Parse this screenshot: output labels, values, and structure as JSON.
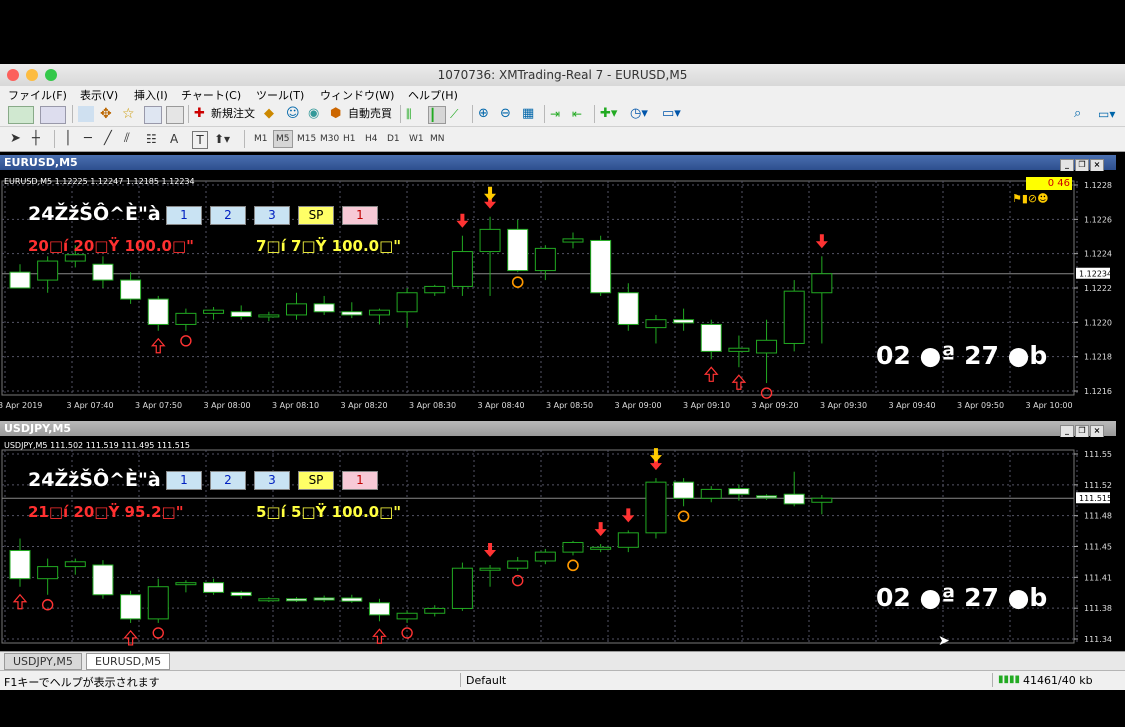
{
  "window": {
    "title": "1070736: XMTrading-Real 7 - EURUSD,M5"
  },
  "menu": [
    "ファイル(F)",
    "表示(V)",
    "挿入(I)",
    "チャート(C)",
    "ツール(T)",
    "ウィンドウ(W)",
    "ヘルプ(H)"
  ],
  "toolbar": {
    "new_order": "新規注文",
    "auto_trade": "自動売買"
  },
  "timeframes": [
    "M1",
    "M5",
    "M15",
    "M30",
    "H1",
    "H4",
    "D1",
    "W1",
    "MN"
  ],
  "active_timeframe": "M5",
  "panes": [
    {
      "title": "EURUSD,M5",
      "info": "EURUSD,M5  1.12225 1.12247 1.12185 1.12234",
      "headline": "24ŽžŠÔ^È\"à",
      "buttons": [
        "1",
        "2",
        "3",
        "SP",
        "1"
      ],
      "stats_left": "20□í 20□Ÿ  100.0□\"",
      "stats_right": "7□í 7□Ÿ  100.0□\"",
      "countdown": "02 ●ª 27 ●b",
      "timer_badge": "0 46",
      "current_price": "1.12234",
      "price_labels": [
        "1.12285",
        "1.12265",
        "1.12245",
        "1.12225",
        "1.12205",
        "1.12185",
        "1.12165"
      ],
      "time_labels": [
        "3 Apr 2019",
        "3 Apr 07:40",
        "3 Apr 07:50",
        "3 Apr 08:00",
        "3 Apr 08:10",
        "3 Apr 08:20",
        "3 Apr 08:30",
        "3 Apr 08:40",
        "3 Apr 08:50",
        "3 Apr 09:00",
        "3 Apr 09:10",
        "3 Apr 09:20",
        "3 Apr 09:30",
        "3 Apr 09:40",
        "3 Apr 09:50",
        "3 Apr 10:00"
      ]
    },
    {
      "title": "USDJPY,M5",
      "info": "USDJPY,M5  111.502 111.519 111.495 111.515",
      "headline": "24ŽžŠÔ^È\"à",
      "buttons": [
        "1",
        "2",
        "3",
        "SP",
        "1"
      ],
      "stats_left": "21□í 20□Ÿ  95.2□\"",
      "stats_right": "5□í 5□Ÿ  100.0□\"",
      "countdown": "02 ●ª 27 ●b",
      "current_price": "111.515",
      "price_labels": [
        "111.555",
        "111.520",
        "111.485",
        "111.450",
        "111.415",
        "111.380",
        "111.345"
      ]
    }
  ],
  "chart_data": [
    {
      "type": "candlestick",
      "title": "EURUSD,M5",
      "ylim": [
        1.1216,
        1.1229
      ],
      "candles": [
        {
          "o": 1.12235,
          "h": 1.1224,
          "l": 1.12225,
          "c": 1.12225
        },
        {
          "o": 1.1223,
          "h": 1.12245,
          "l": 1.12222,
          "c": 1.12242
        },
        {
          "o": 1.12242,
          "h": 1.12252,
          "l": 1.12238,
          "c": 1.12246
        },
        {
          "o": 1.1224,
          "h": 1.12245,
          "l": 1.12225,
          "c": 1.1223
        },
        {
          "o": 1.1223,
          "h": 1.12235,
          "l": 1.12215,
          "c": 1.12218
        },
        {
          "o": 1.12218,
          "h": 1.1222,
          "l": 1.12198,
          "c": 1.12202
        },
        {
          "o": 1.12202,
          "h": 1.12212,
          "l": 1.12198,
          "c": 1.12209
        },
        {
          "o": 1.12209,
          "h": 1.12213,
          "l": 1.12205,
          "c": 1.12211
        },
        {
          "o": 1.1221,
          "h": 1.12214,
          "l": 1.12205,
          "c": 1.12207
        },
        {
          "o": 1.12207,
          "h": 1.1221,
          "l": 1.12204,
          "c": 1.12208
        },
        {
          "o": 1.12208,
          "h": 1.12222,
          "l": 1.12205,
          "c": 1.12215
        },
        {
          "o": 1.12215,
          "h": 1.1222,
          "l": 1.12208,
          "c": 1.1221
        },
        {
          "o": 1.1221,
          "h": 1.12216,
          "l": 1.12206,
          "c": 1.12208
        },
        {
          "o": 1.12208,
          "h": 1.12212,
          "l": 1.12202,
          "c": 1.12211
        },
        {
          "o": 1.1221,
          "h": 1.12225,
          "l": 1.122,
          "c": 1.12222
        },
        {
          "o": 1.12222,
          "h": 1.12227,
          "l": 1.1222,
          "c": 1.12226
        },
        {
          "o": 1.12226,
          "h": 1.12258,
          "l": 1.1222,
          "c": 1.12248
        },
        {
          "o": 1.12248,
          "h": 1.1227,
          "l": 1.1222,
          "c": 1.12262
        },
        {
          "o": 1.12262,
          "h": 1.12268,
          "l": 1.12235,
          "c": 1.12236
        },
        {
          "o": 1.12236,
          "h": 1.12252,
          "l": 1.1223,
          "c": 1.1225
        },
        {
          "o": 1.12254,
          "h": 1.1226,
          "l": 1.1225,
          "c": 1.12256
        },
        {
          "o": 1.12255,
          "h": 1.12258,
          "l": 1.1222,
          "c": 1.12222
        },
        {
          "o": 1.12222,
          "h": 1.12228,
          "l": 1.12198,
          "c": 1.12202
        },
        {
          "o": 1.122,
          "h": 1.12208,
          "l": 1.1219,
          "c": 1.12205
        },
        {
          "o": 1.12205,
          "h": 1.12212,
          "l": 1.12198,
          "c": 1.12203
        },
        {
          "o": 1.12202,
          "h": 1.12205,
          "l": 1.1218,
          "c": 1.12185
        },
        {
          "o": 1.12185,
          "h": 1.12195,
          "l": 1.12175,
          "c": 1.12187
        },
        {
          "o": 1.12184,
          "h": 1.12205,
          "l": 1.12165,
          "c": 1.12192
        },
        {
          "o": 1.1219,
          "h": 1.1223,
          "l": 1.12185,
          "c": 1.12223
        },
        {
          "o": 1.12222,
          "h": 1.12245,
          "l": 1.1219,
          "c": 1.12234
        }
      ]
    },
    {
      "type": "candlestick",
      "title": "USDJPY,M5",
      "ylim": [
        111.34,
        111.57
      ],
      "candles": [
        {
          "o": 111.45,
          "h": 111.465,
          "l": 111.405,
          "c": 111.415
        },
        {
          "o": 111.415,
          "h": 111.44,
          "l": 111.395,
          "c": 111.43
        },
        {
          "o": 111.43,
          "h": 111.44,
          "l": 111.42,
          "c": 111.436
        },
        {
          "o": 111.432,
          "h": 111.438,
          "l": 111.39,
          "c": 111.395
        },
        {
          "o": 111.395,
          "h": 111.4,
          "l": 111.36,
          "c": 111.365
        },
        {
          "o": 111.365,
          "h": 111.415,
          "l": 111.36,
          "c": 111.405
        },
        {
          "o": 111.41,
          "h": 111.413,
          "l": 111.398,
          "c": 111.41
        },
        {
          "o": 111.41,
          "h": 111.415,
          "l": 111.395,
          "c": 111.398
        },
        {
          "o": 111.398,
          "h": 111.4,
          "l": 111.39,
          "c": 111.394
        },
        {
          "o": 111.39,
          "h": 111.392,
          "l": 111.386,
          "c": 111.39
        },
        {
          "o": 111.39,
          "h": 111.392,
          "l": 111.386,
          "c": 111.389
        },
        {
          "o": 111.391,
          "h": 111.394,
          "l": 111.386,
          "c": 111.39
        },
        {
          "o": 111.391,
          "h": 111.395,
          "l": 111.385,
          "c": 111.387
        },
        {
          "o": 111.385,
          "h": 111.39,
          "l": 111.362,
          "c": 111.37
        },
        {
          "o": 111.365,
          "h": 111.375,
          "l": 111.36,
          "c": 111.372
        },
        {
          "o": 111.372,
          "h": 111.382,
          "l": 111.368,
          "c": 111.378
        },
        {
          "o": 111.378,
          "h": 111.435,
          "l": 111.375,
          "c": 111.428
        },
        {
          "o": 111.426,
          "h": 111.432,
          "l": 111.405,
          "c": 111.428
        },
        {
          "o": 111.428,
          "h": 111.442,
          "l": 111.425,
          "c": 111.437
        },
        {
          "o": 111.437,
          "h": 111.452,
          "l": 111.433,
          "c": 111.448
        },
        {
          "o": 111.448,
          "h": 111.462,
          "l": 111.444,
          "c": 111.46
        },
        {
          "o": 111.452,
          "h": 111.458,
          "l": 111.448,
          "c": 111.454
        },
        {
          "o": 111.454,
          "h": 111.475,
          "l": 111.448,
          "c": 111.472
        },
        {
          "o": 111.472,
          "h": 111.54,
          "l": 111.465,
          "c": 111.535
        },
        {
          "o": 111.535,
          "h": 111.54,
          "l": 111.505,
          "c": 111.515
        },
        {
          "o": 111.515,
          "h": 111.53,
          "l": 111.51,
          "c": 111.526
        },
        {
          "o": 111.527,
          "h": 111.532,
          "l": 111.512,
          "c": 111.52
        },
        {
          "o": 111.518,
          "h": 111.52,
          "l": 111.513,
          "c": 111.517
        },
        {
          "o": 111.52,
          "h": 111.548,
          "l": 111.505,
          "c": 111.508
        },
        {
          "o": 111.51,
          "h": 111.519,
          "l": 111.495,
          "c": 111.515
        }
      ]
    }
  ],
  "signals": {
    "eurusd": {
      "down_arrows": [
        16,
        17,
        29
      ],
      "up_arrows": [
        5,
        25,
        26
      ],
      "circles_low": [
        6,
        27
      ],
      "circles_high": [
        18
      ]
    },
    "usdjpy": {
      "down_arrows": [
        17,
        21,
        22,
        23
      ],
      "up_arrows": [
        0,
        4,
        13
      ],
      "circles_low": [
        1,
        5,
        14,
        18
      ],
      "circles_high": [
        20,
        24
      ]
    }
  },
  "tabs": [
    "USDJPY,M5",
    "EURUSD,M5"
  ],
  "active_tab": "EURUSD,M5",
  "status": {
    "help": "F1キーでヘルプが表示されます",
    "profile": "Default",
    "traffic": "41461/40 kb"
  },
  "colors": {
    "bull_body": "#000000",
    "bear_body": "#ffffff",
    "candle_outline": "#22aa22",
    "down_arrow": "#ff3333",
    "up_arrow": "#ff3333",
    "ask_line": "#888888",
    "stats_left": "#ff3030",
    "stats_right": "#ffff40"
  }
}
